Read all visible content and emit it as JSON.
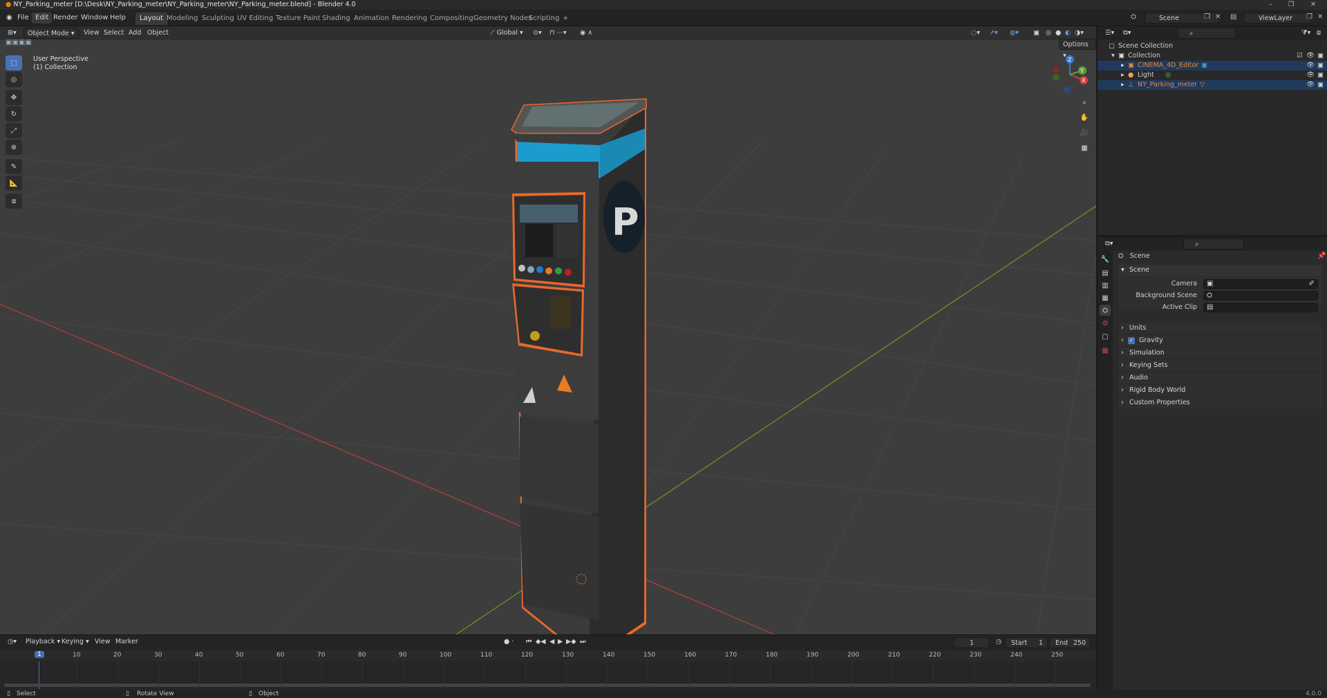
{
  "window": {
    "title": "NY_Parking_meter [D:\\Desk\\NY_Parking_meter\\NY_Parking_meter\\NY_Parking_meter.blend] - Blender 4.0"
  },
  "menu": {
    "items": [
      "File",
      "Edit",
      "Render",
      "Window",
      "Help"
    ],
    "active": "Edit"
  },
  "workspaces": {
    "tabs": [
      "Layout",
      "Modeling",
      "Sculpting",
      "UV Editing",
      "Texture Paint",
      "Shading",
      "Animation",
      "Rendering",
      "Compositing",
      "Geometry Nodes",
      "Scripting"
    ],
    "active": "Layout",
    "add_symbol": "+"
  },
  "top_right": {
    "scene_label": "Scene",
    "view_layer_label": "ViewLayer"
  },
  "viewport": {
    "mode": "Object Mode",
    "menus": [
      "View",
      "Select",
      "Add",
      "Object"
    ],
    "transform_orientation": "Global",
    "options_label": "Options",
    "info_line1": "User Perspective",
    "info_line2": "(1) Collection",
    "meter_letter": "P",
    "gizmo_axes": [
      "Z",
      "X",
      "Y"
    ]
  },
  "tools": [
    "select-box",
    "cursor",
    "move",
    "rotate",
    "scale",
    "transform",
    "annotate",
    "measure",
    "add-cube"
  ],
  "timeline": {
    "menus": [
      "Playback",
      "Keying",
      "View",
      "Marker"
    ],
    "current_frame": "1",
    "start_label": "Start",
    "start_value": "1",
    "end_label": "End",
    "end_value": "250",
    "ticks": [
      "10",
      "20",
      "30",
      "40",
      "50",
      "60",
      "70",
      "80",
      "90",
      "100",
      "110",
      "120",
      "130",
      "140",
      "150",
      "160",
      "170",
      "180",
      "190",
      "200",
      "210",
      "220",
      "230",
      "240",
      "250"
    ],
    "playhead_label": "1"
  },
  "statusbar": {
    "select": "Select",
    "rotate": "Rotate View",
    "object": "Object",
    "version": "4.0.0"
  },
  "outliner": {
    "root": "Scene Collection",
    "collection": "Collection",
    "items": [
      {
        "name": "CINEMA_4D_Editor",
        "selected": true,
        "color": "#e8883a"
      },
      {
        "name": "Light",
        "selected": false,
        "color": "#d8d8d8"
      },
      {
        "name": "NY_Parking_meter",
        "selected": true,
        "color": "#e8883a"
      }
    ]
  },
  "properties": {
    "context": "Scene",
    "panel_title": "Scene",
    "fields": [
      {
        "label": "Camera"
      },
      {
        "label": "Background Scene"
      },
      {
        "label": "Active Clip"
      }
    ],
    "panels": [
      "Units",
      "Gravity",
      "Simulation",
      "Keying Sets",
      "Audio",
      "Rigid Body World",
      "Custom Properties"
    ],
    "gravity_checked": true
  },
  "colors": {
    "accent": "#4772b3",
    "selection_outline": "#e8692a",
    "meter_band": "#1c9ccc"
  }
}
